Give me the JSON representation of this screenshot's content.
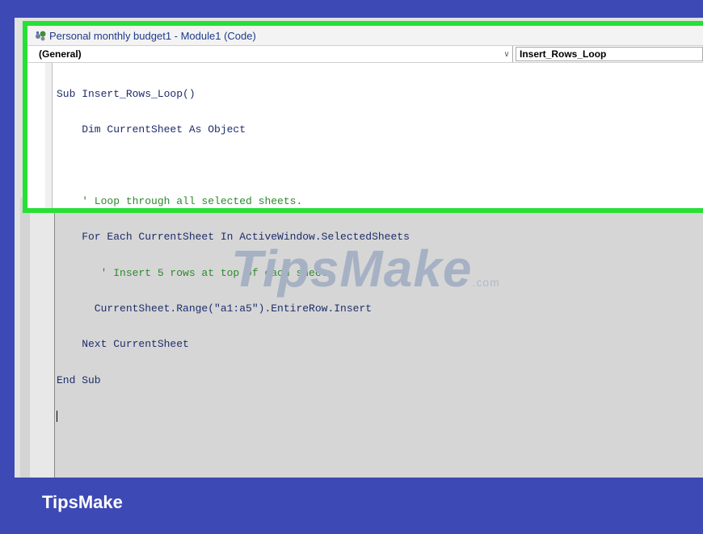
{
  "window": {
    "title": "Personal monthly budget1 - Module1 (Code)",
    "icon": "vba-module-icon"
  },
  "combos": {
    "object": "(General)",
    "procedure": "Insert_Rows_Loop"
  },
  "code": {
    "lines": [
      {
        "text": "Sub Insert_Rows_Loop()",
        "kind": "code"
      },
      {
        "text": "    Dim CurrentSheet As Object",
        "kind": "code"
      },
      {
        "text": "",
        "kind": "code"
      },
      {
        "text": "    ' Loop through all selected sheets.",
        "kind": "comment"
      },
      {
        "text": "    For Each CurrentSheet In ActiveWindow.SelectedSheets",
        "kind": "code"
      },
      {
        "text": "       ' Insert 5 rows at top of each sheet.",
        "kind": "comment"
      },
      {
        "text": "      CurrentSheet.Range(\"a1:a5\").EntireRow.Insert",
        "kind": "code"
      },
      {
        "text": "    Next CurrentSheet",
        "kind": "code"
      },
      {
        "text": "End Sub",
        "kind": "code"
      }
    ]
  },
  "watermark": {
    "text": "TipsMake",
    "suffix": ".com"
  },
  "footer": {
    "brand": "TipsMake"
  },
  "colors": {
    "highlight": "#27e035",
    "band": "#3d49b4",
    "comment": "#2d8a2d"
  }
}
